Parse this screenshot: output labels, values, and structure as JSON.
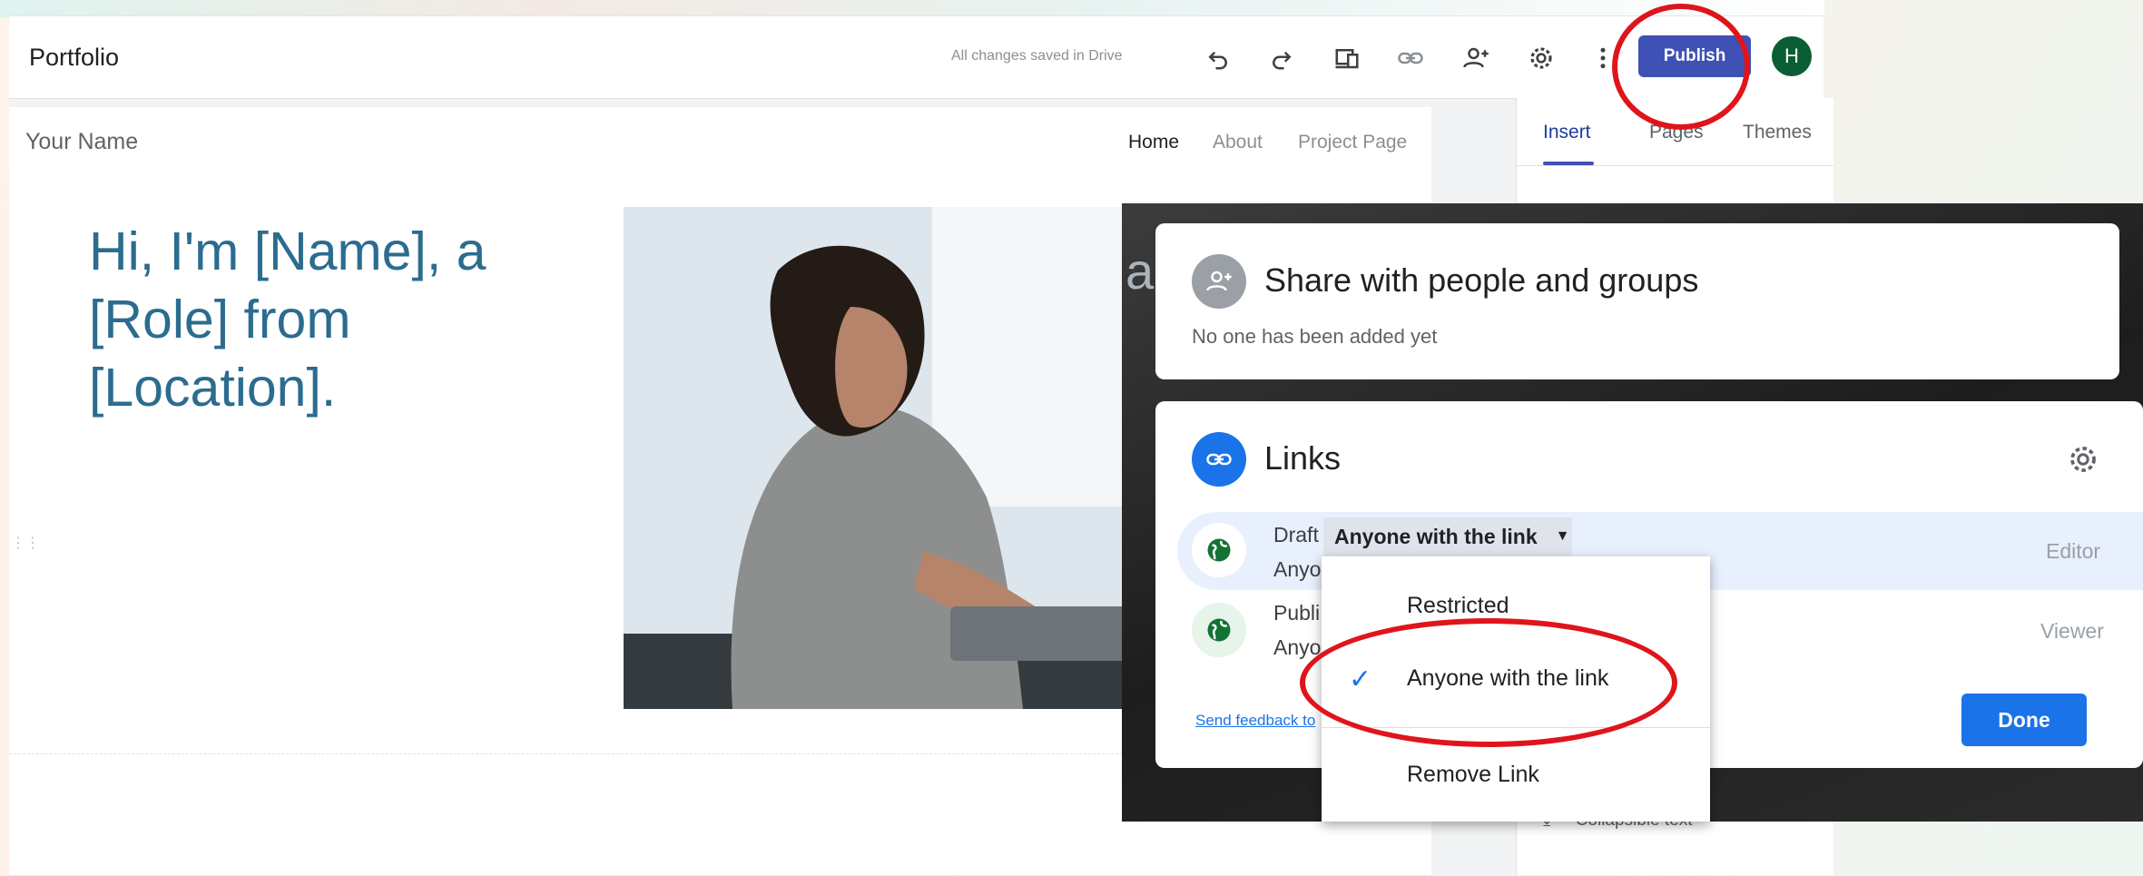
{
  "site": {
    "title": "Portfolio",
    "saved_status": "All changes saved in Drive",
    "publish_label": "Publish",
    "avatar_initial": "H"
  },
  "toolbar_icons": [
    "undo-icon",
    "redo-icon",
    "preview-icon",
    "link-icon",
    "add-person-icon",
    "settings-icon",
    "more-vert-icon"
  ],
  "canvas": {
    "name": "Your Name",
    "nav": [
      "Home",
      "About",
      "Project Page"
    ],
    "hero": "Hi, I'm [Name], a [Role] from [Location]."
  },
  "side_panel": {
    "tabs": [
      "Insert",
      "Pages",
      "Themes"
    ],
    "collapsible_label": "Collapsible text"
  },
  "share_dialog": {
    "people": {
      "title": "Share with people and groups",
      "subtitle": "No one has been added yet"
    },
    "links": {
      "title": "Links",
      "draft_prefix": "Draft",
      "draft_access": "Anyone with the link",
      "draft_sub": "Anyo",
      "draft_role": "Editor",
      "published_prefix": "Publi",
      "published_sub": "Anyo",
      "published_role": "Viewer",
      "feedback": "Send feedback to",
      "done": "Done"
    },
    "menu": {
      "restricted": "Restricted",
      "anyone": "Anyone with the link",
      "remove": "Remove Link"
    },
    "peek_letter": "a"
  },
  "colors": {
    "publish": "#3f51b5",
    "annotation": "#e0141b",
    "accent_blue": "#1a73e8",
    "hero_text": "#2b6c8f"
  }
}
